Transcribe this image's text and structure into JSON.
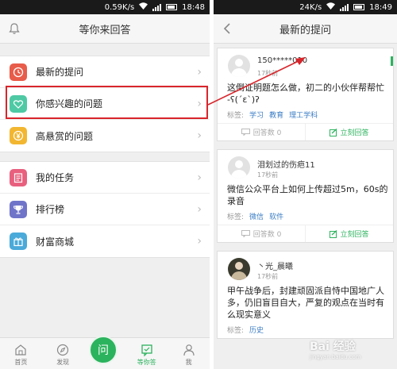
{
  "left": {
    "status": {
      "speed": "0.59K/s",
      "time": "18:48"
    },
    "header_title": "等你来回答",
    "menu_group1": [
      {
        "label": "最新的提问",
        "icon": "clock-icon",
        "color": "#e85c4a"
      },
      {
        "label": "你感兴趣的问题",
        "icon": "heart-icon",
        "color": "#4ec9a4"
      },
      {
        "label": "高悬赏的问题",
        "icon": "yen-icon",
        "color": "#f2b630"
      }
    ],
    "menu_group2": [
      {
        "label": "我的任务",
        "icon": "task-icon",
        "color": "#e8607e"
      },
      {
        "label": "排行榜",
        "icon": "trophy-icon",
        "color": "#6f74c9"
      },
      {
        "label": "财富商城",
        "icon": "gift-icon",
        "color": "#4aaad9"
      }
    ],
    "tabs": [
      {
        "label": "首页",
        "icon": "home-icon"
      },
      {
        "label": "发现",
        "icon": "compass-icon"
      },
      {
        "label": "",
        "icon": ""
      },
      {
        "label": "等你答",
        "icon": "answer-icon"
      },
      {
        "label": "我",
        "icon": "person-icon"
      }
    ],
    "ask_button": "问",
    "accent": "#2bb35d"
  },
  "right": {
    "status": {
      "speed": "24K/s",
      "time": "18:49"
    },
    "header_title": "最新的提问",
    "questions": [
      {
        "user": "150*****010",
        "time": "17秒前",
        "text_lines": [
          "这倒证明题怎么做，初二的小伙伴帮帮忙",
          "-ʕ(´ε`)ʔ"
        ],
        "tags_label": "标签:",
        "tags": [
          "学习",
          "教育",
          "理工学科"
        ],
        "answer_count": "回答数 0",
        "answer_button": "立刻回答"
      },
      {
        "user": "泪划过的伤疤11",
        "time": "17秒前",
        "text_lines": [
          "微信公众平台上如何上传超过5m，60s的",
          "录音"
        ],
        "tags_label": "标签:",
        "tags": [
          "微信",
          "软件"
        ],
        "answer_count": "回答数 0",
        "answer_button": "立刻回答"
      },
      {
        "user": "丶光_晨曦",
        "time": "17秒前",
        "text_lines": [
          "甲午战争后，封建顽固派自恃中国地广人",
          "多，仍旧盲目自大，严复的观点在当时有",
          "么现实意义"
        ],
        "tags_label": "标签:",
        "tags": [
          "历史"
        ],
        "answer_count": "",
        "answer_button": ""
      }
    ]
  },
  "watermark": {
    "main": "Bai 经验",
    "sub": "jingyan.baidu.com"
  }
}
